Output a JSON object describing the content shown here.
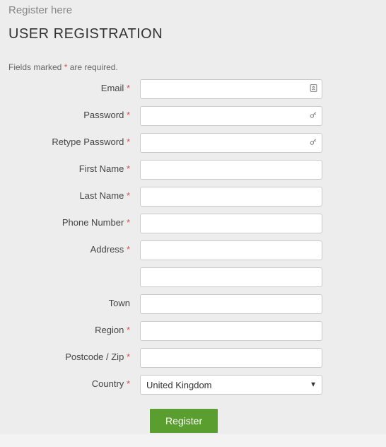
{
  "page": {
    "subtitle": "Register here",
    "title": "USER REGISTRATION",
    "requiredNotePrefix": "Fields marked ",
    "requiredAsterisk": "*",
    "requiredNoteSuffix": " are required."
  },
  "fields": {
    "email": {
      "label": "Email",
      "required": true,
      "value": "",
      "icon": "contact-icon"
    },
    "password": {
      "label": "Password",
      "required": true,
      "value": "",
      "icon": "key-icon"
    },
    "password2": {
      "label": "Retype Password",
      "required": true,
      "value": "",
      "icon": "key-icon"
    },
    "firstName": {
      "label": "First Name",
      "required": true,
      "value": ""
    },
    "lastName": {
      "label": "Last Name",
      "required": true,
      "value": ""
    },
    "phone": {
      "label": "Phone Number",
      "required": true,
      "value": ""
    },
    "address1": {
      "label": "Address",
      "required": true,
      "value": ""
    },
    "address2": {
      "label": "",
      "required": false,
      "value": ""
    },
    "town": {
      "label": "Town",
      "required": false,
      "value": ""
    },
    "region": {
      "label": "Region",
      "required": true,
      "value": ""
    },
    "postcode": {
      "label": "Postcode / Zip",
      "required": true,
      "value": ""
    },
    "country": {
      "label": "Country",
      "required": true,
      "value": "United Kingdom"
    }
  },
  "submit": {
    "label": "Register"
  }
}
